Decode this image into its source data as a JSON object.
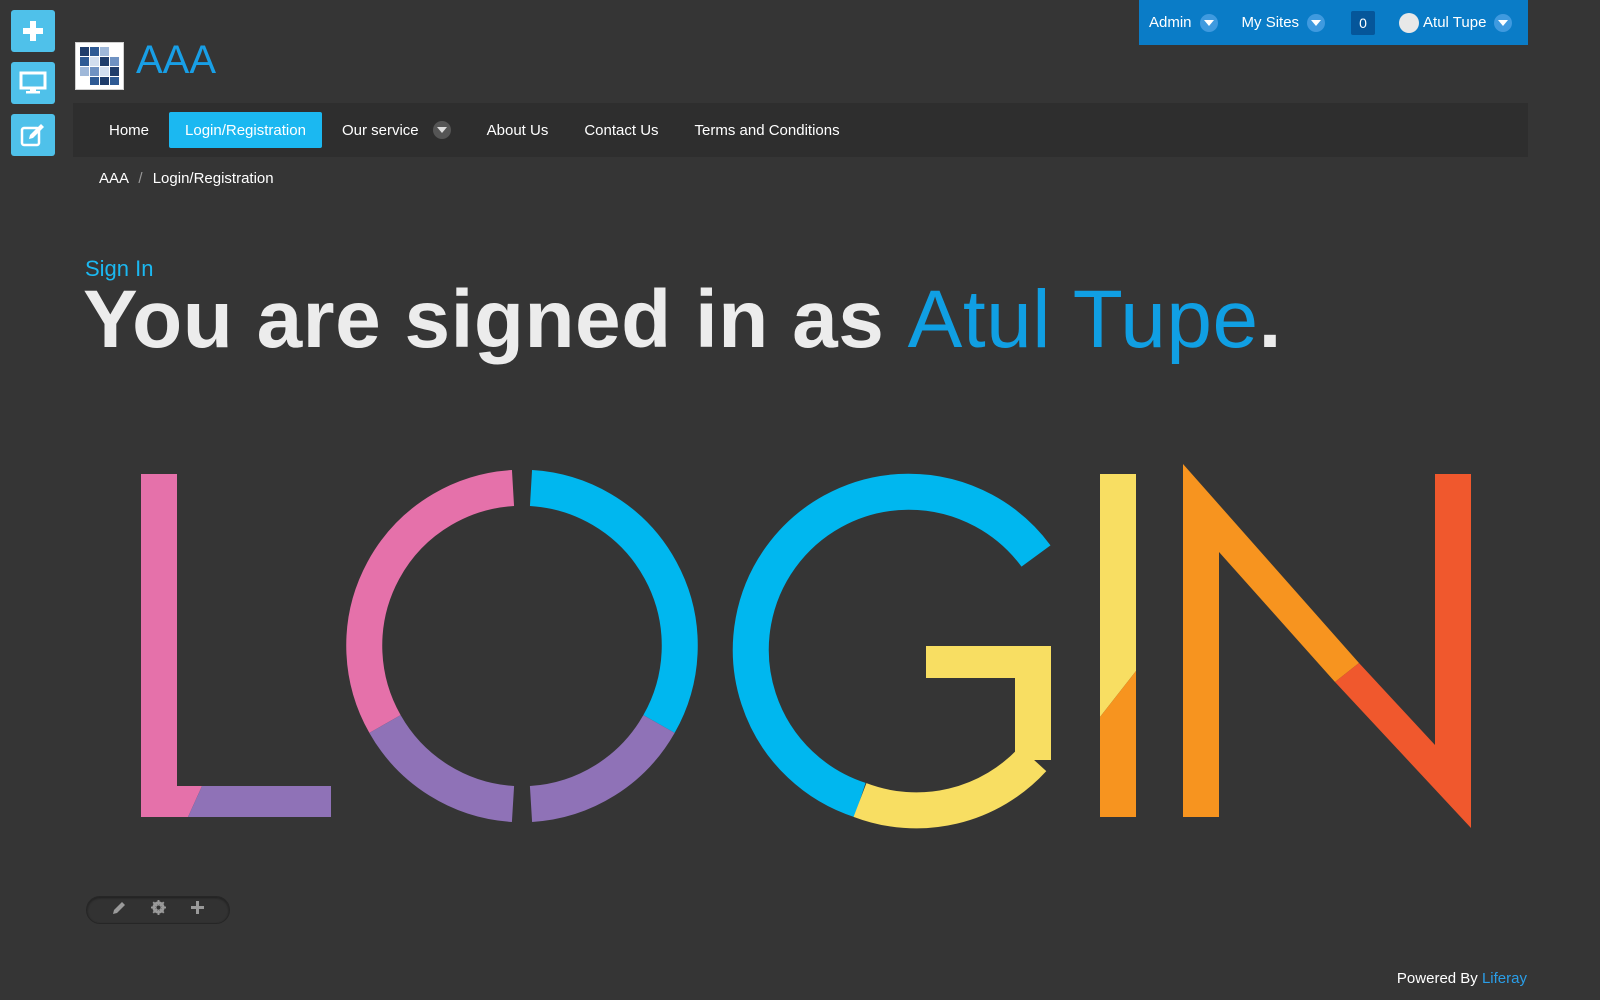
{
  "side_controls": [
    {
      "icon": "plus-icon"
    },
    {
      "icon": "monitor-icon"
    },
    {
      "icon": "edit-icon"
    }
  ],
  "dockbar": {
    "admin_label": "Admin",
    "my_sites_label": "My Sites",
    "notification_count": "0",
    "user_name": "Atul Tupe"
  },
  "site": {
    "name": "AAA"
  },
  "nav": {
    "items": [
      "Home",
      "Login/Registration",
      "Our service",
      "About Us",
      "Contact Us",
      "Terms and Conditions"
    ],
    "active": "Login/Registration"
  },
  "breadcrumb": {
    "items": [
      "AAA",
      "Login/Registration"
    ],
    "separator": "/"
  },
  "portlet": {
    "title": "Sign In",
    "message_prefix": "You are signed in as ",
    "user_name": "Atul Tupe",
    "message_suffix": "."
  },
  "login_graphic": {
    "text": "LOGIN",
    "colors": {
      "pink": "#e571aa",
      "purple": "#8f72b7",
      "blue": "#00b7ef",
      "yellow": "#f8de62",
      "orange": "#f7941f",
      "red": "#f0582d"
    }
  },
  "footer": {
    "powered_by": "Powered By",
    "link": "Liferay"
  },
  "colors": {
    "background": "#353535",
    "accent": "#1bb8f1",
    "dockbar": "#0a7cc7",
    "navbar": "#2e2e2e"
  }
}
